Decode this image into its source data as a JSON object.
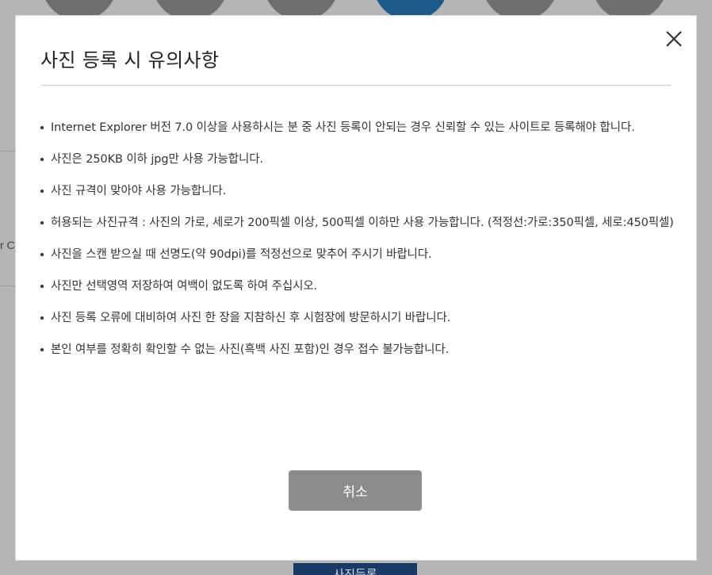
{
  "background": {
    "edge_text": "r C",
    "bottom_button_label": "사진등록"
  },
  "modal": {
    "title": "사진 등록 시 유의사항",
    "close_icon": "close-icon",
    "notices": [
      "Internet Explorer 버전 7.0 이상을 사용하시는 분 중 사진 등록이 안되는 경우 신뢰할 수 있는 사이트로 등록해야 합니다.",
      "사진은 250KB 이하 jpg만 사용 가능합니다.",
      "사진 규격이 맞아야 사용 가능합니다.",
      "허용되는 사진규격 : 사진의 가로, 세로가 200픽셀 이상, 500픽셀 이하만 사용 가능합니다. (적정선:가로:350픽셀, 세로:450픽셀)",
      "사진을 스캔 받으실 때 선명도(약 90dpi)를 적정선으로 맞추어 주시기 바랍니다.",
      "사진만 선택영역 저장하여 여백이 없도록 하여 주십시오.",
      "사진 등록 오류에 대비하여 사진 한 장을 지참하신 후 시험장에 방문하시기 바랍니다.",
      "본인 여부를 정확히 확인할 수 없는 사진(흑백 사진 포함)인 경우 접수 불가능합니다."
    ],
    "cancel_label": "취소"
  },
  "colors": {
    "overlay": "#b5b5b5",
    "cancel_button": "#8c8c8c",
    "active_step": "#1c5a8a"
  }
}
